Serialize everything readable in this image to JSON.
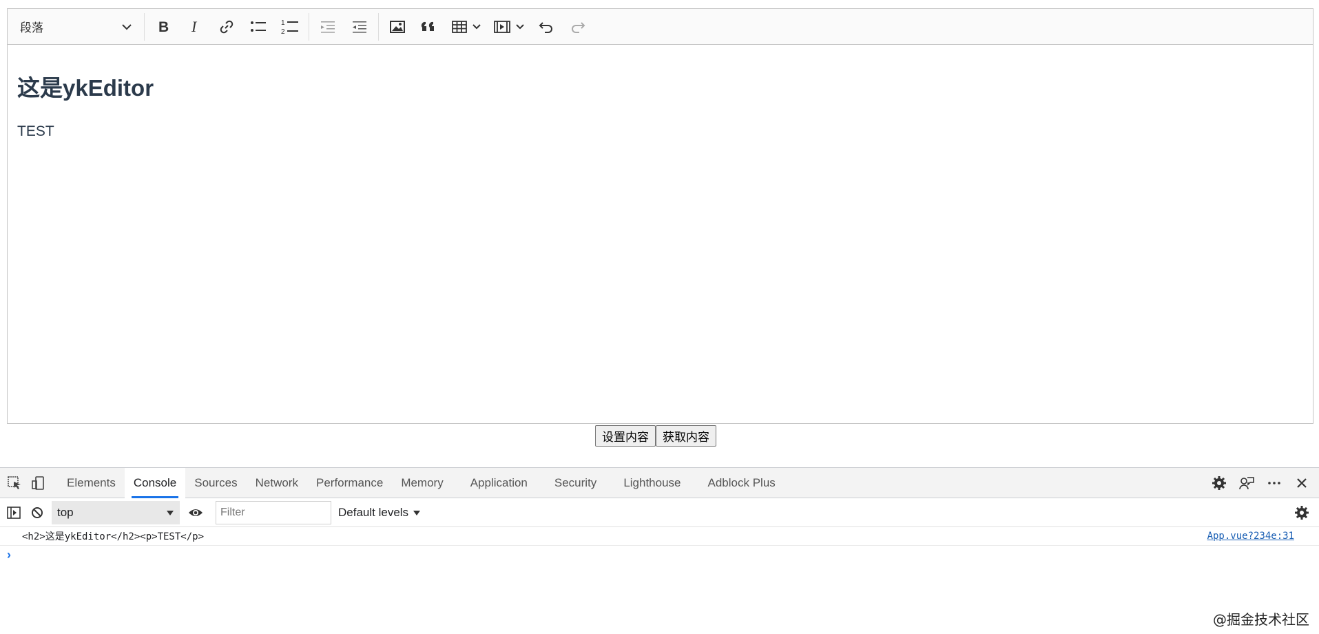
{
  "editor": {
    "toolbar": {
      "heading_value": "段落",
      "icons": [
        "bold-icon",
        "italic-icon",
        "link-icon",
        "bulleted-list-icon",
        "numbered-list-icon",
        "outdent-icon",
        "indent-icon",
        "image-icon",
        "blockquote-icon",
        "table-icon",
        "media-icon",
        "undo-icon",
        "redo-icon"
      ]
    },
    "content": {
      "heading": "这是ykEditor",
      "paragraph": "TEST"
    }
  },
  "buttons": {
    "set_content": "设置内容",
    "get_content": "获取内容"
  },
  "devtools": {
    "tabs": [
      "Elements",
      "Console",
      "Sources",
      "Network",
      "Performance",
      "Memory",
      "Application",
      "Security",
      "Lighthouse",
      "Adblock Plus"
    ],
    "active_tab": "Console",
    "console": {
      "context": "top",
      "filter_placeholder": "Filter",
      "levels": "Default levels",
      "log_message": "<h2>这是ykEditor</h2><p>TEST</p>",
      "log_source": "App.vue?234e:31",
      "prompt_caret": "›"
    }
  },
  "watermark": "@掘金技术社区",
  "colors": {
    "accent": "#1a73e8",
    "editor_border": "#c4c4c4",
    "heading_text": "#2b3a4b"
  }
}
